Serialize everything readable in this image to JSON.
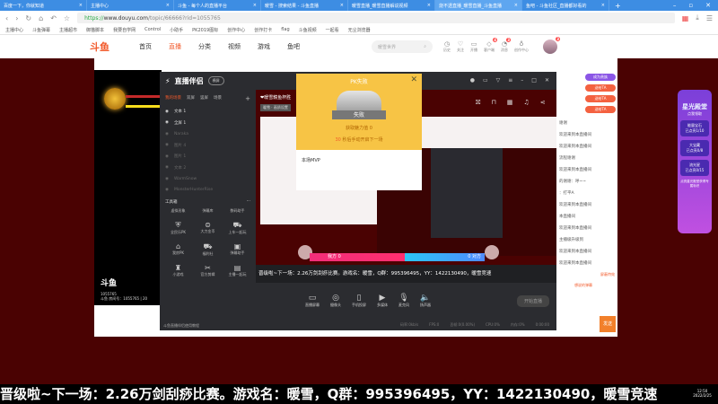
{
  "browser": {
    "tabs": [
      {
        "label": "百度一下，你就知道",
        "active": false
      },
      {
        "label": "主播中心",
        "active": false
      },
      {
        "label": "斗鱼 - 每个人的直播平台",
        "active": false
      },
      {
        "label": "暖雪 - 搜索结果 - 斗鱼直播",
        "active": false
      },
      {
        "label": "暖雪直播_暖雪直播解说视频",
        "active": false
      },
      {
        "label": "烧不透直播_暖雪直播_斗鱼直播",
        "active": true
      },
      {
        "label": "鱼吧 - 斗鱼社区_直播都好看的",
        "active": false
      }
    ],
    "new_tab": "+",
    "url_scheme": "https://",
    "url_host": "www.douyu.com",
    "url_path": "/topic/66666?rid=1055765",
    "bookmarks": [
      "主播中心",
      "斗鱼弹幕",
      "主播超市",
      "御猫脚本",
      "我要自学网",
      "Control",
      "小助手",
      "PK2019图标",
      "创作中心",
      "创作打卡",
      "flag",
      "斗鱼视频",
      "一起看",
      "无尘浏览器"
    ]
  },
  "site": {
    "logo": "斗鱼",
    "nav": [
      {
        "label": "首页",
        "active": false
      },
      {
        "label": "直播",
        "active": true
      },
      {
        "label": "分类",
        "active": false
      },
      {
        "label": "视频",
        "active": false
      },
      {
        "label": "游戏",
        "active": false
      },
      {
        "label": "鱼吧",
        "active": false
      }
    ],
    "search_placeholder": "暖雪世界",
    "header_icons": [
      {
        "label": "历史",
        "badge": ""
      },
      {
        "label": "关注",
        "badge": ""
      },
      {
        "label": "开播",
        "badge": ""
      },
      {
        "label": "客户端",
        "badge": "4"
      },
      {
        "label": "消息",
        "badge": "3"
      },
      {
        "label": "创作中心",
        "badge": ""
      }
    ],
    "avatar_badge": "3"
  },
  "video": {
    "logo": "斗鱼",
    "room_no": "1055765",
    "room_label": "斗鱼 房间号：1055765 | 20"
  },
  "obs": {
    "title": "直播伴侣",
    "mode": "横屏",
    "scene_tabs": [
      "我的场景",
      "双屏",
      "竖屏",
      "场景"
    ],
    "layers": [
      {
        "label": "文本 1",
        "visible": true
      },
      {
        "label": "全屏 1",
        "visible": true
      },
      {
        "label": "Naraka",
        "visible": false
      },
      {
        "label": "图片 4",
        "visible": false
      },
      {
        "label": "图片 1",
        "visible": false
      },
      {
        "label": "文本 2",
        "visible": false
      },
      {
        "label": "WarmSnow",
        "visible": false
      },
      {
        "label": "MonsterHunterRise",
        "visible": false
      }
    ],
    "tools_title": "工具箱",
    "tools": [
      {
        "label": "虚拟形象",
        "icon": "avatar-icon"
      },
      {
        "label": "弹幕库",
        "icon": "danmaku-icon"
      },
      {
        "label": "数码助手",
        "icon": "assistant-icon"
      },
      {
        "label": "全民乐PK",
        "icon": "pk-icon"
      },
      {
        "label": "大力金币",
        "icon": "coin-icon"
      },
      {
        "label": "上车一起玩",
        "icon": "car-icon"
      },
      {
        "label": "我房PK",
        "icon": "house-icon"
      },
      {
        "label": "福利社",
        "icon": "gift-icon"
      },
      {
        "label": "弹幕助手",
        "icon": "robot-icon"
      },
      {
        "label": "小游戏",
        "icon": "gamepad-icon"
      },
      {
        "label": "官方剪辑",
        "icon": "scissors-icon"
      },
      {
        "label": "主播一起玩",
        "icon": "clipboard-icon"
      }
    ],
    "tip": "斗鱼直播伴侣使用教程",
    "preview_title": "❤暖雪鏡鱼杯胜",
    "preview_tag": "暖雪 · 画质设置",
    "pk_self": "我方 0",
    "pk_other": "0 对方",
    "pk_self_name": "我方",
    "pk_other_name": "对方",
    "scroll_text": "晋级啦~下一场：2.26万剑刮痧比赛。游戏名：暖雪，Q群：995396495，YY：1422130490，暖雪竞速",
    "controls": [
      {
        "label": "直播屏幕",
        "icon": "screen-icon"
      },
      {
        "label": "摄像头",
        "icon": "camera-icon"
      },
      {
        "label": "手机投屏",
        "icon": "phone-icon"
      },
      {
        "label": "多媒体",
        "icon": "media-icon"
      },
      {
        "label": "麦克风",
        "icon": "mic-icon"
      },
      {
        "label": "扬声器",
        "icon": "speaker-icon"
      }
    ],
    "start_label": "开始直播",
    "stats": [
      "码率:0kb/s",
      "FPS:0",
      "丢帧:0(0.00%)",
      "CPU:0%",
      "内存:0%",
      "0:00:00"
    ]
  },
  "pk_popup": {
    "title": "PK失败",
    "result": "失败",
    "value_label": "获取魅力值",
    "value": "0",
    "countdown": "30",
    "countdown_suffix": "秒后手动开启下一场",
    "mvp_label": "本场MVP"
  },
  "chat": {
    "buttons": [
      "成为贵族",
      "送给TA",
      "送给TA",
      "送给TA"
    ],
    "messages": [
      "谢谢",
      "欢迎来到本直播间",
      "欢迎来到本直播间",
      "流程谢谢",
      "欢迎来到本直播间",
      "的谢谢：呼~~",
      "：打平A",
      "欢迎来到本直播间",
      "本直播间",
      "欢迎来到本直播间",
      "主播级升级到",
      "欢迎来到本直播间",
      "欢迎来到本直播间"
    ],
    "mode_label": "屏蔽特效",
    "input_placeholder": "想说的弹幕",
    "send": "发送"
  },
  "star_palace": {
    "title": "星光殿堂",
    "subtitle": "点我领取",
    "items": [
      {
        "name": "能量宝石",
        "progress": "已点亮1/10"
      },
      {
        "name": "大宝藏",
        "progress": "已点亮0/8"
      },
      {
        "name": "流光星",
        "progress": "已点亮0/15"
      }
    ],
    "footer": "点亮星光殿堂获得专属标识"
  },
  "banner_text": "晋级啦~下一场：2.26万剑刮痧比赛。游戏名：暖雪，Q群：995396495，YY：1422130490，暖雪竞速",
  "tray": {
    "time": "12:50",
    "date": "2022/2/25"
  }
}
